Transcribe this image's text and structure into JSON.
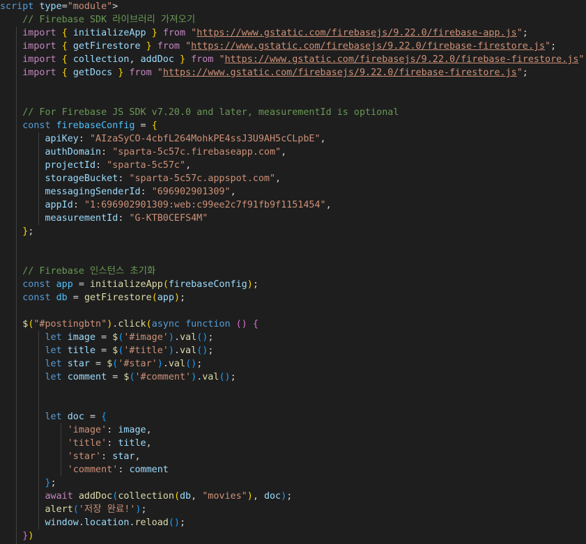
{
  "editor": {
    "theme": "dark",
    "background": "#1e1e1e",
    "lines": [
      [
        [
          "script",
          "kw"
        ],
        [
          " ",
          "pun"
        ],
        [
          "type",
          "var"
        ],
        [
          "=",
          "pun"
        ],
        [
          "\"module\"",
          "str"
        ],
        [
          ">",
          "pun"
        ]
      ],
      [
        [
          "    // Firebase SDK 라이브러리 가져오기",
          "cmt"
        ]
      ],
      [
        [
          "    ",
          "pun"
        ],
        [
          "import",
          "ctl"
        ],
        [
          " ",
          "pun"
        ],
        [
          "{",
          "b1"
        ],
        [
          " ",
          "pun"
        ],
        [
          "initializeApp",
          "var"
        ],
        [
          " ",
          "pun"
        ],
        [
          "}",
          "b1"
        ],
        [
          " ",
          "pun"
        ],
        [
          "from",
          "ctl"
        ],
        [
          " ",
          "pun"
        ],
        [
          "\"",
          "str"
        ],
        [
          "https://www.gstatic.com/firebasejs/9.22.0/firebase-app.js",
          "url"
        ],
        [
          "\"",
          "str"
        ],
        [
          ";",
          "pun"
        ]
      ],
      [
        [
          "    ",
          "pun"
        ],
        [
          "import",
          "ctl"
        ],
        [
          " ",
          "pun"
        ],
        [
          "{",
          "b1"
        ],
        [
          " ",
          "pun"
        ],
        [
          "getFirestore",
          "var"
        ],
        [
          " ",
          "pun"
        ],
        [
          "}",
          "b1"
        ],
        [
          " ",
          "pun"
        ],
        [
          "from",
          "ctl"
        ],
        [
          " ",
          "pun"
        ],
        [
          "\"",
          "str"
        ],
        [
          "https://www.gstatic.com/firebasejs/9.22.0/firebase-firestore.js",
          "url"
        ],
        [
          "\"",
          "str"
        ],
        [
          ";",
          "pun"
        ]
      ],
      [
        [
          "    ",
          "pun"
        ],
        [
          "import",
          "ctl"
        ],
        [
          " ",
          "pun"
        ],
        [
          "{",
          "b1"
        ],
        [
          " ",
          "pun"
        ],
        [
          "collection",
          "var"
        ],
        [
          ", ",
          "pun"
        ],
        [
          "addDoc",
          "var"
        ],
        [
          " ",
          "pun"
        ],
        [
          "}",
          "b1"
        ],
        [
          " ",
          "pun"
        ],
        [
          "from",
          "ctl"
        ],
        [
          " ",
          "pun"
        ],
        [
          "\"",
          "str"
        ],
        [
          "https://www.gstatic.com/firebasejs/9.22.0/firebase-firestore.js",
          "url"
        ],
        [
          "\"",
          "str"
        ],
        [
          ";",
          "pun"
        ]
      ],
      [
        [
          "    ",
          "pun"
        ],
        [
          "import",
          "ctl"
        ],
        [
          " ",
          "pun"
        ],
        [
          "{",
          "b1"
        ],
        [
          " ",
          "pun"
        ],
        [
          "getDocs",
          "var"
        ],
        [
          " ",
          "pun"
        ],
        [
          "}",
          "b1"
        ],
        [
          " ",
          "pun"
        ],
        [
          "from",
          "ctl"
        ],
        [
          " ",
          "pun"
        ],
        [
          "\"",
          "str"
        ],
        [
          "https://www.gstatic.com/firebasejs/9.22.0/firebase-firestore.js",
          "url"
        ],
        [
          "\"",
          "str"
        ],
        [
          ";",
          "pun"
        ]
      ],
      [],
      [],
      [
        [
          "    // For Firebase JS SDK v7.20.0 and later, measurementId is optional",
          "cmt"
        ]
      ],
      [
        [
          "    ",
          "pun"
        ],
        [
          "const",
          "kw"
        ],
        [
          " ",
          "pun"
        ],
        [
          "firebaseConfig",
          "cst"
        ],
        [
          " = ",
          "pun"
        ],
        [
          "{",
          "b1"
        ]
      ],
      [
        [
          "        ",
          "pun"
        ],
        [
          "apiKey",
          "var"
        ],
        [
          ": ",
          "pun"
        ],
        [
          "\"AIzaSyCO-4cbfL264MohkPE4ssJ3U9AH5cCLpbE\"",
          "str"
        ],
        [
          ",",
          "pun"
        ]
      ],
      [
        [
          "        ",
          "pun"
        ],
        [
          "authDomain",
          "var"
        ],
        [
          ": ",
          "pun"
        ],
        [
          "\"sparta-5c57c.firebaseapp.com\"",
          "str"
        ],
        [
          ",",
          "pun"
        ]
      ],
      [
        [
          "        ",
          "pun"
        ],
        [
          "projectId",
          "var"
        ],
        [
          ": ",
          "pun"
        ],
        [
          "\"sparta-5c57c\"",
          "str"
        ],
        [
          ",",
          "pun"
        ]
      ],
      [
        [
          "        ",
          "pun"
        ],
        [
          "storageBucket",
          "var"
        ],
        [
          ": ",
          "pun"
        ],
        [
          "\"sparta-5c57c.appspot.com\"",
          "str"
        ],
        [
          ",",
          "pun"
        ]
      ],
      [
        [
          "        ",
          "pun"
        ],
        [
          "messagingSenderId",
          "var"
        ],
        [
          ": ",
          "pun"
        ],
        [
          "\"696902901309\"",
          "str"
        ],
        [
          ",",
          "pun"
        ]
      ],
      [
        [
          "        ",
          "pun"
        ],
        [
          "appId",
          "var"
        ],
        [
          ": ",
          "pun"
        ],
        [
          "\"1:696902901309:web:c99ee2c7f91fb9f1151454\"",
          "str"
        ],
        [
          ",",
          "pun"
        ]
      ],
      [
        [
          "        ",
          "pun"
        ],
        [
          "measurementId",
          "var"
        ],
        [
          ": ",
          "pun"
        ],
        [
          "\"G-KTB0CEFS4M\"",
          "str"
        ]
      ],
      [
        [
          "    ",
          "pun"
        ],
        [
          "}",
          "b1"
        ],
        [
          ";",
          "pun"
        ]
      ],
      [],
      [],
      [
        [
          "    // Firebase 인스턴스 초기화",
          "cmt"
        ]
      ],
      [
        [
          "    ",
          "pun"
        ],
        [
          "const",
          "kw"
        ],
        [
          " ",
          "pun"
        ],
        [
          "app",
          "cst"
        ],
        [
          " = ",
          "pun"
        ],
        [
          "initializeApp",
          "fn"
        ],
        [
          "(",
          "b1"
        ],
        [
          "firebaseConfig",
          "var"
        ],
        [
          ")",
          "b1"
        ],
        [
          ";",
          "pun"
        ]
      ],
      [
        [
          "    ",
          "pun"
        ],
        [
          "const",
          "kw"
        ],
        [
          " ",
          "pun"
        ],
        [
          "db",
          "cst"
        ],
        [
          " = ",
          "pun"
        ],
        [
          "getFirestore",
          "fn"
        ],
        [
          "(",
          "b1"
        ],
        [
          "app",
          "var"
        ],
        [
          ")",
          "b1"
        ],
        [
          ";",
          "pun"
        ]
      ],
      [],
      [
        [
          "    ",
          "pun"
        ],
        [
          "$",
          "fn"
        ],
        [
          "(",
          "b1"
        ],
        [
          "\"#postingbtn\"",
          "str"
        ],
        [
          ")",
          "b1"
        ],
        [
          ".",
          "pun"
        ],
        [
          "click",
          "fn"
        ],
        [
          "(",
          "b1"
        ],
        [
          "async",
          "kw"
        ],
        [
          " ",
          "pun"
        ],
        [
          "function",
          "kw"
        ],
        [
          " ",
          "pun"
        ],
        [
          "()",
          "b2"
        ],
        [
          " ",
          "pun"
        ],
        [
          "{",
          "b2"
        ]
      ],
      [
        [
          "        ",
          "pun"
        ],
        [
          "let",
          "kw"
        ],
        [
          " ",
          "pun"
        ],
        [
          "image",
          "var"
        ],
        [
          " = ",
          "pun"
        ],
        [
          "$",
          "fn"
        ],
        [
          "(",
          "b3"
        ],
        [
          "'#image'",
          "str"
        ],
        [
          ")",
          "b3"
        ],
        [
          ".",
          "pun"
        ],
        [
          "val",
          "fn"
        ],
        [
          "()",
          "b3"
        ],
        [
          ";",
          "pun"
        ]
      ],
      [
        [
          "        ",
          "pun"
        ],
        [
          "let",
          "kw"
        ],
        [
          " ",
          "pun"
        ],
        [
          "title",
          "var"
        ],
        [
          " = ",
          "pun"
        ],
        [
          "$",
          "fn"
        ],
        [
          "(",
          "b3"
        ],
        [
          "'#title'",
          "str"
        ],
        [
          ")",
          "b3"
        ],
        [
          ".",
          "pun"
        ],
        [
          "val",
          "fn"
        ],
        [
          "()",
          "b3"
        ],
        [
          ";",
          "pun"
        ]
      ],
      [
        [
          "        ",
          "pun"
        ],
        [
          "let",
          "kw"
        ],
        [
          " ",
          "pun"
        ],
        [
          "star",
          "var"
        ],
        [
          " = ",
          "pun"
        ],
        [
          "$",
          "fn"
        ],
        [
          "(",
          "b3"
        ],
        [
          "'#star'",
          "str"
        ],
        [
          ")",
          "b3"
        ],
        [
          ".",
          "pun"
        ],
        [
          "val",
          "fn"
        ],
        [
          "()",
          "b3"
        ],
        [
          ";",
          "pun"
        ]
      ],
      [
        [
          "        ",
          "pun"
        ],
        [
          "let",
          "kw"
        ],
        [
          " ",
          "pun"
        ],
        [
          "comment",
          "var"
        ],
        [
          " = ",
          "pun"
        ],
        [
          "$",
          "fn"
        ],
        [
          "(",
          "b3"
        ],
        [
          "'#comment'",
          "str"
        ],
        [
          ")",
          "b3"
        ],
        [
          ".",
          "pun"
        ],
        [
          "val",
          "fn"
        ],
        [
          "()",
          "b3"
        ],
        [
          ";",
          "pun"
        ]
      ],
      [],
      [],
      [
        [
          "        ",
          "pun"
        ],
        [
          "let",
          "kw"
        ],
        [
          " ",
          "pun"
        ],
        [
          "doc",
          "var"
        ],
        [
          " = ",
          "pun"
        ],
        [
          "{",
          "b3"
        ]
      ],
      [
        [
          "            ",
          "pun"
        ],
        [
          "'image'",
          "str"
        ],
        [
          ": ",
          "pun"
        ],
        [
          "image",
          "var"
        ],
        [
          ",",
          "pun"
        ]
      ],
      [
        [
          "            ",
          "pun"
        ],
        [
          "'title'",
          "str"
        ],
        [
          ": ",
          "pun"
        ],
        [
          "title",
          "var"
        ],
        [
          ",",
          "pun"
        ]
      ],
      [
        [
          "            ",
          "pun"
        ],
        [
          "'star'",
          "str"
        ],
        [
          ": ",
          "pun"
        ],
        [
          "star",
          "var"
        ],
        [
          ",",
          "pun"
        ]
      ],
      [
        [
          "            ",
          "pun"
        ],
        [
          "'comment'",
          "str"
        ],
        [
          ": ",
          "pun"
        ],
        [
          "comment",
          "var"
        ]
      ],
      [
        [
          "        ",
          "pun"
        ],
        [
          "}",
          "b3"
        ],
        [
          ";",
          "pun"
        ]
      ],
      [
        [
          "        ",
          "pun"
        ],
        [
          "await",
          "ctl"
        ],
        [
          " ",
          "pun"
        ],
        [
          "addDoc",
          "fn"
        ],
        [
          "(",
          "b3"
        ],
        [
          "collection",
          "fn"
        ],
        [
          "(",
          "b1"
        ],
        [
          "db",
          "var"
        ],
        [
          ", ",
          "pun"
        ],
        [
          "\"movies\"",
          "str"
        ],
        [
          ")",
          "b1"
        ],
        [
          ", ",
          "pun"
        ],
        [
          "doc",
          "var"
        ],
        [
          ")",
          "b3"
        ],
        [
          ";",
          "pun"
        ]
      ],
      [
        [
          "        ",
          "pun"
        ],
        [
          "alert",
          "fn"
        ],
        [
          "(",
          "b3"
        ],
        [
          "'저장 완료!'",
          "str"
        ],
        [
          ")",
          "b3"
        ],
        [
          ";",
          "pun"
        ]
      ],
      [
        [
          "        ",
          "pun"
        ],
        [
          "window",
          "var"
        ],
        [
          ".",
          "pun"
        ],
        [
          "location",
          "var"
        ],
        [
          ".",
          "pun"
        ],
        [
          "reload",
          "fn"
        ],
        [
          "()",
          "b3"
        ],
        [
          ";",
          "pun"
        ]
      ],
      [
        [
          "    ",
          "pun"
        ],
        [
          "}",
          "b2"
        ],
        [
          ")",
          "b1"
        ]
      ]
    ]
  }
}
